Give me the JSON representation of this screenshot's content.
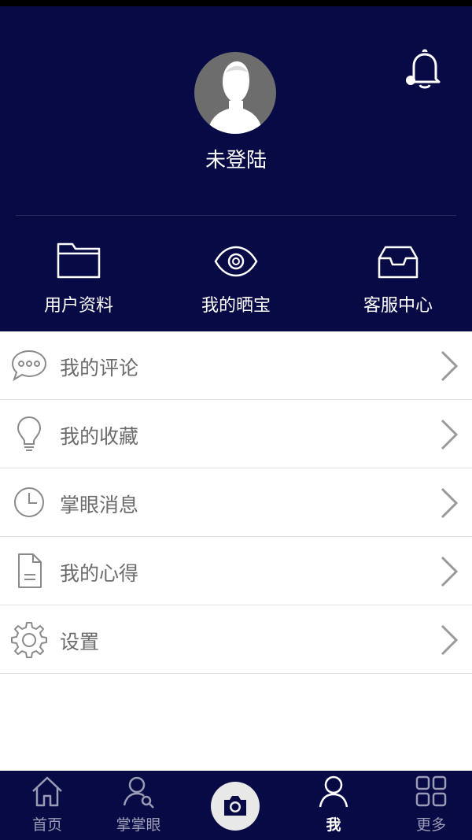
{
  "profile": {
    "login_status": "未登陆"
  },
  "quick_actions": [
    {
      "label": "用户资料",
      "icon": "folder-icon"
    },
    {
      "label": "我的晒宝",
      "icon": "eye-icon"
    },
    {
      "label": "客服中心",
      "icon": "inbox-tray-icon"
    }
  ],
  "menu": [
    {
      "label": "我的评论",
      "icon": "comment-bubble-icon"
    },
    {
      "label": "我的收藏",
      "icon": "lightbulb-icon"
    },
    {
      "label": "掌眼消息",
      "icon": "clock-icon"
    },
    {
      "label": "我的心得",
      "icon": "document-icon"
    },
    {
      "label": "设置",
      "icon": "gear-icon"
    }
  ],
  "tabbar": {
    "items": [
      {
        "label": "首页",
        "icon": "home-icon"
      },
      {
        "label": "掌掌眼",
        "icon": "user-search-icon"
      },
      {
        "label": "",
        "icon": "camera-icon"
      },
      {
        "label": "我",
        "icon": "person-icon",
        "active": true
      },
      {
        "label": "更多",
        "icon": "grid-icon"
      }
    ]
  },
  "colors": {
    "header_bg": "#070a45",
    "menu_text": "#6b6b6b",
    "tab_inactive": "#9a9cb5",
    "tab_active": "#ffffff"
  }
}
